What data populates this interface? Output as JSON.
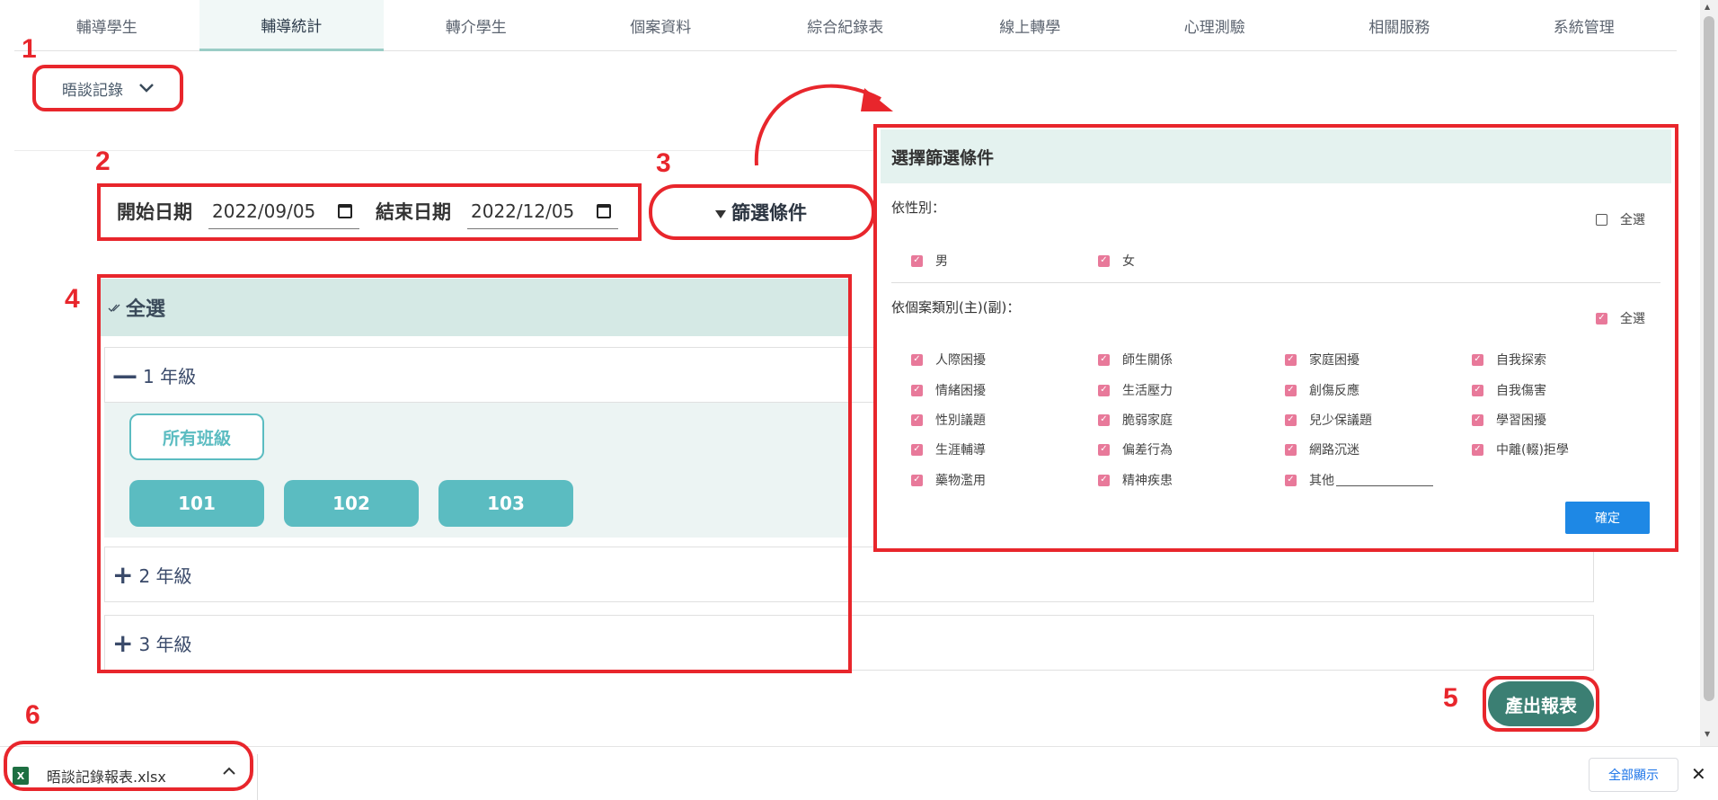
{
  "nav": {
    "tabs": [
      {
        "label": "輔導學生",
        "active": false
      },
      {
        "label": "輔導統計",
        "active": true
      },
      {
        "label": "轉介學生",
        "active": false
      },
      {
        "label": "個案資料",
        "active": false
      },
      {
        "label": "綜合紀錄表",
        "active": false
      },
      {
        "label": "線上轉學",
        "active": false
      },
      {
        "label": "心理測驗",
        "active": false
      },
      {
        "label": "相關服務",
        "active": false
      },
      {
        "label": "系統管理",
        "active": false
      }
    ]
  },
  "report_type": {
    "value": "晤談記錄",
    "icon": "chevron-down-icon"
  },
  "dates": {
    "start_label": "開始日期",
    "start_value": "2022/09/05",
    "end_label": "結束日期",
    "end_value": "2022/12/05"
  },
  "filter_button": {
    "label": "篩選條件",
    "icon": "funnel-icon"
  },
  "tree": {
    "select_all": "全選",
    "grades": [
      {
        "label": "1 年級",
        "expanded": true
      },
      {
        "label": "2 年級",
        "expanded": false
      },
      {
        "label": "3 年級",
        "expanded": false
      }
    ],
    "all_classes": "所有班級",
    "classes": [
      "101",
      "102",
      "103"
    ]
  },
  "filter_panel": {
    "title": "選擇篩選條件",
    "gender_label": "依性別：",
    "gender_select_all": {
      "label": "全選",
      "checked": false
    },
    "genders": [
      {
        "label": "男",
        "checked": true
      },
      {
        "label": "女",
        "checked": true
      }
    ],
    "category_label": "依個案類別(主)(副)：",
    "category_select_all": {
      "label": "全選",
      "checked": true
    },
    "categories": [
      [
        "人際困擾",
        "師生關係",
        "家庭困擾",
        "自我探索"
      ],
      [
        "情緒困擾",
        "生活壓力",
        "創傷反應",
        "自我傷害"
      ],
      [
        "性別議題",
        "脆弱家庭",
        "兒少保議題",
        "學習困擾"
      ],
      [
        "生涯輔導",
        "偏差行為",
        "網路沉迷",
        "中離(輟)拒學"
      ],
      [
        "藥物濫用",
        "精神疾患",
        "其他"
      ]
    ],
    "confirm_label": "確定"
  },
  "report_button": {
    "label": "產出報表"
  },
  "download_bar": {
    "file_name": "晤談記錄報表.xlsx",
    "show_all_label": "全部顯示",
    "close_label": "✕"
  },
  "annotations": [
    "1",
    "2",
    "3",
    "4",
    "5",
    "6"
  ],
  "colors": {
    "annotation_red": "#e8262c",
    "teal": "#5bbcc1",
    "report_green": "#3b7f73",
    "checkbox_pink": "#e8799a",
    "confirm_blue": "#1e88e5"
  }
}
